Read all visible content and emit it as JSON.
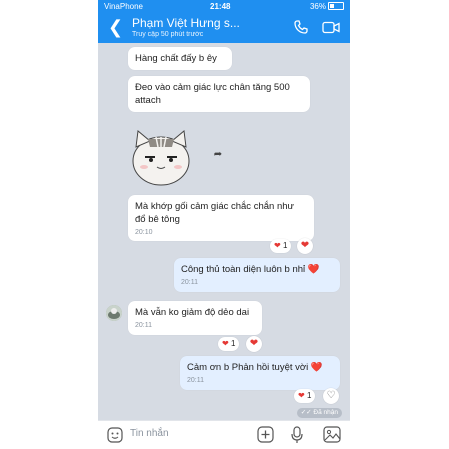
{
  "status_bar": {
    "carrier": "VinaPhone",
    "time": "21:48",
    "battery": "36%"
  },
  "header": {
    "contact_name": "Phạm Việt Hưng s...",
    "last_seen": "Truy cập 50 phút trước"
  },
  "messages": [
    {
      "text": "Hàng chất đấy b êy",
      "from": "them"
    },
    {
      "text": "Đeo vào cảm giác lực chân tăng 500 attach",
      "from": "them"
    },
    {
      "type": "sticker",
      "icon": "cat-sticker"
    },
    {
      "text": "Mà khớp gối cảm giác chắc chắn như đổ bê tông",
      "time": "20:10",
      "reaction_count": "1",
      "from": "them"
    },
    {
      "text": "Công thủ toàn diện luôn b nhỉ ❤️",
      "time": "20:11",
      "from": "me"
    },
    {
      "text": "Mà vẫn ko giảm độ dẻo dai",
      "time": "20:11",
      "reaction_count": "1",
      "from": "them"
    },
    {
      "text": "Cảm ơn b Phản hồi tuyệt vời ❤️",
      "time": "20:11",
      "reaction_count": "1",
      "from": "me"
    }
  ],
  "seen_status": "✓✓ Đã nhận",
  "input": {
    "placeholder": "Tin nhắn"
  },
  "colors": {
    "header": "#1f8ff0",
    "chat_bg": "#d6dbe3",
    "my_bubble": "#e3efff",
    "heart": "#e53935"
  }
}
